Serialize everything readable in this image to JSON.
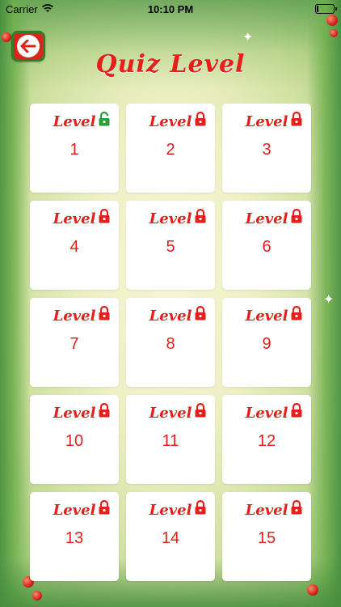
{
  "status_bar": {
    "carrier": "Carrier",
    "time": "10:10 PM",
    "battery_level": 0.1
  },
  "header": {
    "title": "Quiz Level",
    "back_icon": "back-arrow-icon"
  },
  "colors": {
    "accent_red": "#e3201b",
    "unlocked_green": "#2a9d3a",
    "card_bg": "#ffffff"
  },
  "levels": [
    {
      "label": "Level",
      "number": "1",
      "locked": false
    },
    {
      "label": "Level",
      "number": "2",
      "locked": true
    },
    {
      "label": "Level",
      "number": "3",
      "locked": true
    },
    {
      "label": "Level",
      "number": "4",
      "locked": true
    },
    {
      "label": "Level",
      "number": "5",
      "locked": true
    },
    {
      "label": "Level",
      "number": "6",
      "locked": true
    },
    {
      "label": "Level",
      "number": "7",
      "locked": true
    },
    {
      "label": "Level",
      "number": "8",
      "locked": true
    },
    {
      "label": "Level",
      "number": "9",
      "locked": true
    },
    {
      "label": "Level",
      "number": "10",
      "locked": true
    },
    {
      "label": "Level",
      "number": "11",
      "locked": true
    },
    {
      "label": "Level",
      "number": "12",
      "locked": true
    },
    {
      "label": "Level",
      "number": "13",
      "locked": true
    },
    {
      "label": "Level",
      "number": "14",
      "locked": true
    },
    {
      "label": "Level",
      "number": "15",
      "locked": true
    }
  ]
}
